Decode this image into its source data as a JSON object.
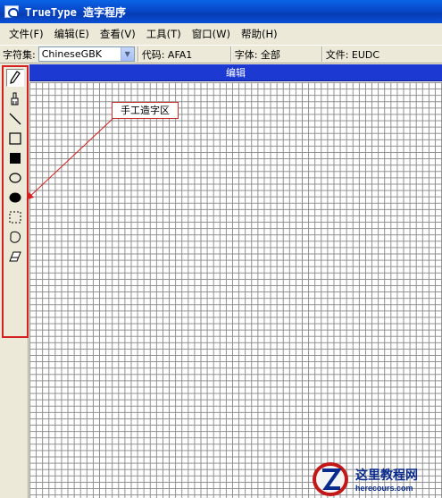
{
  "window": {
    "title": "TrueType 造字程序"
  },
  "menu": {
    "items": [
      "文件(F)",
      "编辑(E)",
      "查看(V)",
      "工具(T)",
      "窗口(W)",
      "帮助(H)"
    ]
  },
  "infobar": {
    "charset_label": "字符集:",
    "charset_value": "ChineseGBK",
    "code_field": "代码: AFA1",
    "font_field": "字体: 全部",
    "file_field": "文件: EUDC"
  },
  "editor": {
    "header_title": "编辑"
  },
  "tools": [
    {
      "name": "pencil-icon",
      "selected": true
    },
    {
      "name": "brush-icon",
      "selected": false
    },
    {
      "name": "line-icon",
      "selected": false
    },
    {
      "name": "hollow-rectangle-icon",
      "selected": false
    },
    {
      "name": "filled-rectangle-icon",
      "selected": false
    },
    {
      "name": "hollow-ellipse-icon",
      "selected": false
    },
    {
      "name": "filled-ellipse-icon",
      "selected": false
    },
    {
      "name": "rectangular-select-icon",
      "selected": false
    },
    {
      "name": "freeform-select-icon",
      "selected": false
    },
    {
      "name": "eraser-icon",
      "selected": false
    }
  ],
  "annotation": {
    "label": "手工造字区",
    "color": "#c83030"
  },
  "watermark": {
    "cn": "这里教程网",
    "en": "herecours.com"
  },
  "colors": {
    "title_bar": "#0a4fd6",
    "edit_header": "#1c3ad1",
    "highlight": "#d42020"
  }
}
